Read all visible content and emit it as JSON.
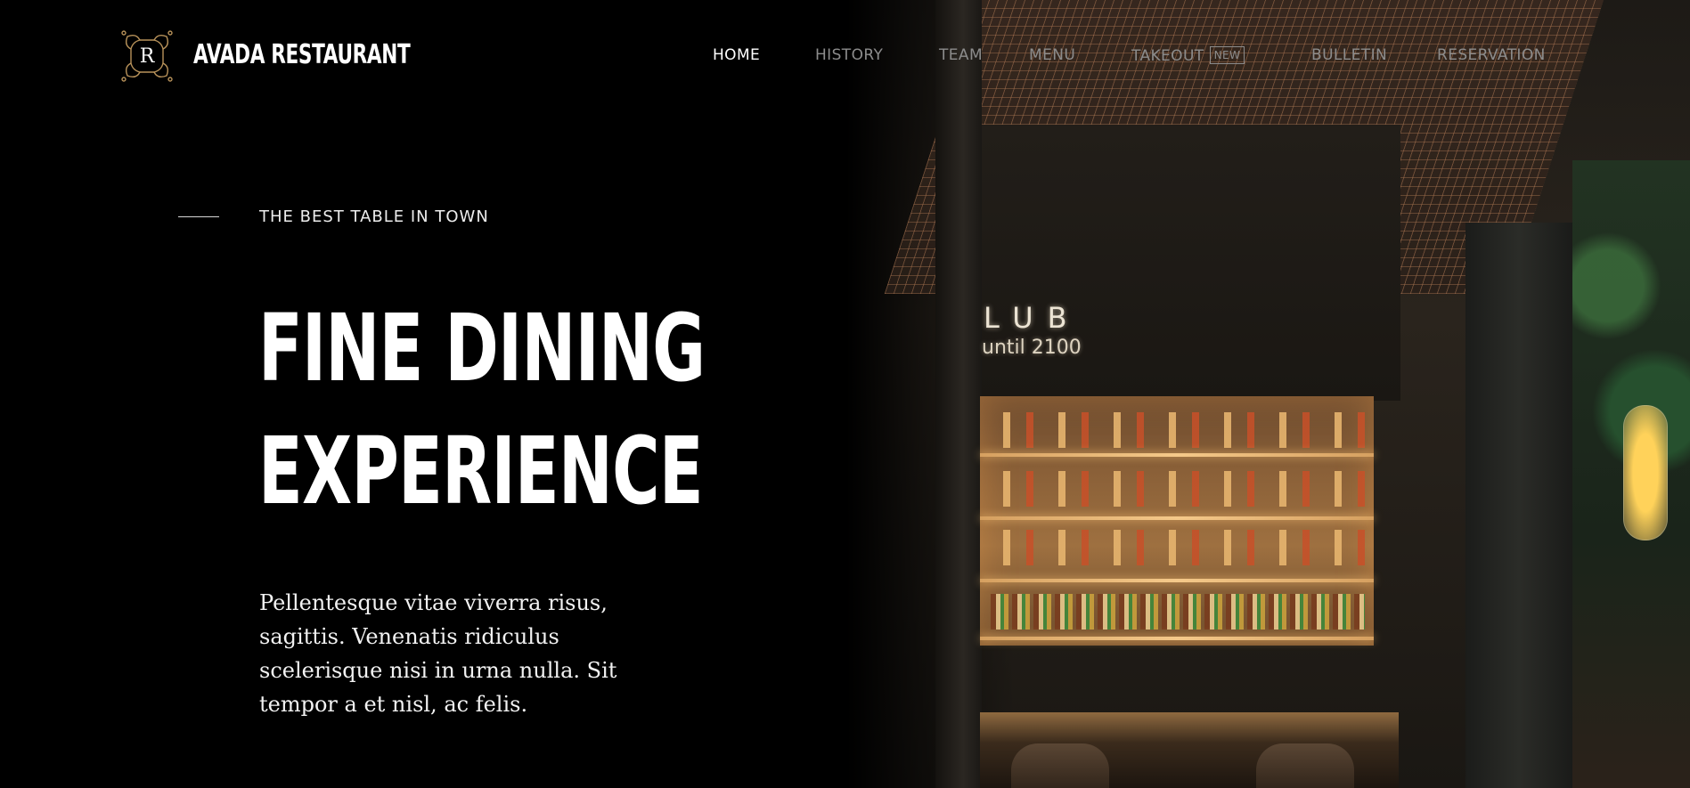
{
  "header": {
    "logo_letter": "R",
    "brand_name": "AVADA RESTAURANT",
    "nav": [
      {
        "label": "HOME",
        "active": true
      },
      {
        "label": "HISTORY",
        "active": false
      },
      {
        "label": "TEAM",
        "active": false
      },
      {
        "label": "MENU",
        "active": false
      },
      {
        "label": "TAKEOUT",
        "active": false,
        "badge": "NEW"
      },
      {
        "label": "BULLETIN",
        "active": false
      },
      {
        "label": "RESERVATION",
        "active": false
      }
    ]
  },
  "hero": {
    "tagline": "THE BEST TABLE IN TOWN",
    "title_line1": "FINE DINING",
    "title_line2": "EXPERIENCE",
    "body": "Pellentesque vitae viverra risus, sagittis. Venenatis ridiculus scelerisque nisi in urna nulla. Sit tempor a et nisl, ac felis."
  },
  "photo": {
    "sign_main": "LUB",
    "sign_sub": "until 2100"
  },
  "colors": {
    "background": "#000000",
    "nav_active": "#ffffff",
    "nav_inactive": "#8c8c8c",
    "logo_gold": "#b8925a"
  }
}
